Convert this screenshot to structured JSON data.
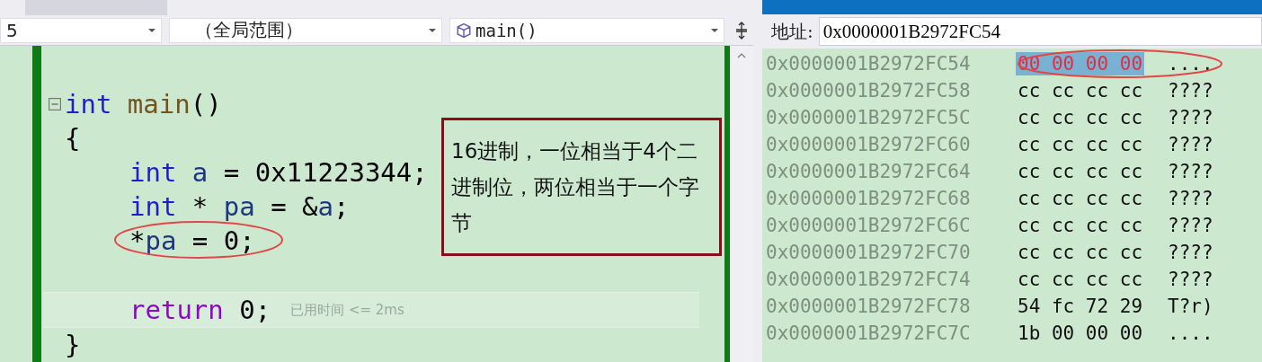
{
  "editor": {
    "dropdowns": [
      {
        "value": "5",
        "kind": "plain"
      },
      {
        "value": "（全局范围）",
        "kind": "plain"
      },
      {
        "value": "main()",
        "kind": "function"
      }
    ],
    "function": {
      "fold_expanded": true,
      "signature": [
        {
          "text": "int",
          "kind": "keyword"
        },
        {
          "text": " main",
          "kind": "function"
        },
        {
          "text": "()",
          "kind": "plain"
        }
      ],
      "open_brace": "{",
      "body": [
        {
          "tokens": [
            {
              "text": "int",
              "kind": "keyword"
            },
            {
              "text": " a",
              "kind": "variable"
            },
            {
              "text": " = 0x11223344;",
              "kind": "plain"
            }
          ],
          "circled": false,
          "current": false
        },
        {
          "tokens": [
            {
              "text": "int",
              "kind": "keyword"
            },
            {
              "text": " * ",
              "kind": "plain"
            },
            {
              "text": "pa",
              "kind": "variable"
            },
            {
              "text": " = &",
              "kind": "plain"
            },
            {
              "text": "a",
              "kind": "variable"
            },
            {
              "text": ";",
              "kind": "plain"
            }
          ],
          "circled": false,
          "current": false
        },
        {
          "tokens": [
            {
              "text": "*",
              "kind": "plain"
            },
            {
              "text": "pa",
              "kind": "variable"
            },
            {
              "text": " = 0;",
              "kind": "plain"
            }
          ],
          "circled": true,
          "current": false
        },
        {
          "circled": false,
          "current": false
        },
        {
          "tokens": [
            {
              "text": "return",
              "kind": "control"
            },
            {
              "text": " 0;",
              "kind": "plain"
            }
          ],
          "circled": false,
          "current": true,
          "hint": "已用时间 <= 2ms"
        }
      ],
      "close_brace": "}"
    },
    "note": "16进制，一位相当于4个二进制位，两位相当于一个字节"
  },
  "memory": {
    "address_label": "地址:",
    "address": "0x0000001B2972FC54",
    "rows": [
      {
        "address": "0x0000001B2972FC54",
        "bytes": [
          "00",
          "00",
          "00",
          "00"
        ],
        "ascii": "....",
        "selected": true,
        "changed": true,
        "circled": true
      },
      {
        "address": "0x0000001B2972FC58",
        "bytes": [
          "cc",
          "cc",
          "cc",
          "cc"
        ],
        "ascii": "????",
        "selected": false,
        "changed": false,
        "circled": false
      },
      {
        "address": "0x0000001B2972FC5C",
        "bytes": [
          "cc",
          "cc",
          "cc",
          "cc"
        ],
        "ascii": "????",
        "selected": false,
        "changed": false,
        "circled": false
      },
      {
        "address": "0x0000001B2972FC60",
        "bytes": [
          "cc",
          "cc",
          "cc",
          "cc"
        ],
        "ascii": "????",
        "selected": false,
        "changed": false,
        "circled": false
      },
      {
        "address": "0x0000001B2972FC64",
        "bytes": [
          "cc",
          "cc",
          "cc",
          "cc"
        ],
        "ascii": "????",
        "selected": false,
        "changed": false,
        "circled": false
      },
      {
        "address": "0x0000001B2972FC68",
        "bytes": [
          "cc",
          "cc",
          "cc",
          "cc"
        ],
        "ascii": "????",
        "selected": false,
        "changed": false,
        "circled": false
      },
      {
        "address": "0x0000001B2972FC6C",
        "bytes": [
          "cc",
          "cc",
          "cc",
          "cc"
        ],
        "ascii": "????",
        "selected": false,
        "changed": false,
        "circled": false
      },
      {
        "address": "0x0000001B2972FC70",
        "bytes": [
          "cc",
          "cc",
          "cc",
          "cc"
        ],
        "ascii": "????",
        "selected": false,
        "changed": false,
        "circled": false
      },
      {
        "address": "0x0000001B2972FC74",
        "bytes": [
          "cc",
          "cc",
          "cc",
          "cc"
        ],
        "ascii": "????",
        "selected": false,
        "changed": false,
        "circled": false
      },
      {
        "address": "0x0000001B2972FC78",
        "bytes": [
          "54",
          "fc",
          "72",
          "29"
        ],
        "ascii": "T?r)",
        "selected": false,
        "changed": false,
        "circled": false
      },
      {
        "address": "0x0000001B2972FC7C",
        "bytes": [
          "1b",
          "00",
          "00",
          "00"
        ],
        "ascii": "....",
        "selected": false,
        "changed": false,
        "circled": false
      }
    ]
  }
}
